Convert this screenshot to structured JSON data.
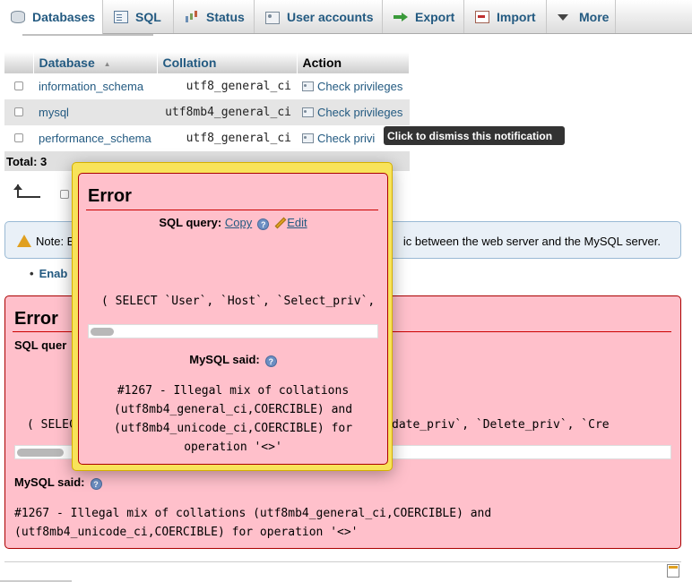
{
  "tabs": [
    {
      "label": "Databases",
      "icon": "database-icon"
    },
    {
      "label": "SQL",
      "icon": "sql-icon"
    },
    {
      "label": "Status",
      "icon": "status-icon"
    },
    {
      "label": "User accounts",
      "icon": "user-accounts-icon"
    },
    {
      "label": "Export",
      "icon": "export-icon"
    },
    {
      "label": "Import",
      "icon": "import-icon"
    },
    {
      "label": "More",
      "icon": "chevron-down-icon"
    }
  ],
  "db_table": {
    "headers": {
      "database": "Database",
      "sort_indicator": "▲",
      "collation": "Collation",
      "action": "Action"
    },
    "rows": [
      {
        "name": "information_schema",
        "collation": "utf8_general_ci",
        "action": "Check privileges"
      },
      {
        "name": "mysql",
        "collation": "utf8mb4_general_ci",
        "action": "Check privileges"
      },
      {
        "name": "performance_schema",
        "collation": "utf8_general_ci",
        "action": "Check privi"
      }
    ],
    "total": "Total: 3"
  },
  "note": {
    "lead": "Note: E",
    "tail": "ic between the web server and the MySQL server."
  },
  "bullet_link": "Enab",
  "main_error": {
    "title": "Error",
    "sql_query_label": "SQL quer",
    "query_text": "( SELEC                                      v`, `Update_priv`, `Delete_priv`, `Cre",
    "mysql_said_label": "MySQL said:",
    "help": "?",
    "message_line1": "#1267 - Illegal mix of collations (utf8mb4_general_ci,COERCIBLE) and",
    "message_line2": "(utf8mb4_unicode_ci,COERCIBLE) for operation '<>'"
  },
  "popup": {
    "title": "Error",
    "sql_query_label": "SQL query:",
    "copy_link": "Copy",
    "edit_link": "Edit",
    "help": "?",
    "query_text": "( SELECT `User`, `Host`, `Select_priv`,",
    "mysql_said_label": "MySQL said:",
    "message_lines": [
      "#1267 - Illegal mix of collations",
      "(utf8mb4_general_ci,COERCIBLE) and",
      "(utf8mb4_unicode_ci,COERCIBLE) for",
      "operation '<>'"
    ]
  },
  "tooltip": "Click to dismiss this notification",
  "colors": {
    "link": "#235a81",
    "error_bg": "#ffc0cb",
    "popup_border": "#f8e35a"
  }
}
